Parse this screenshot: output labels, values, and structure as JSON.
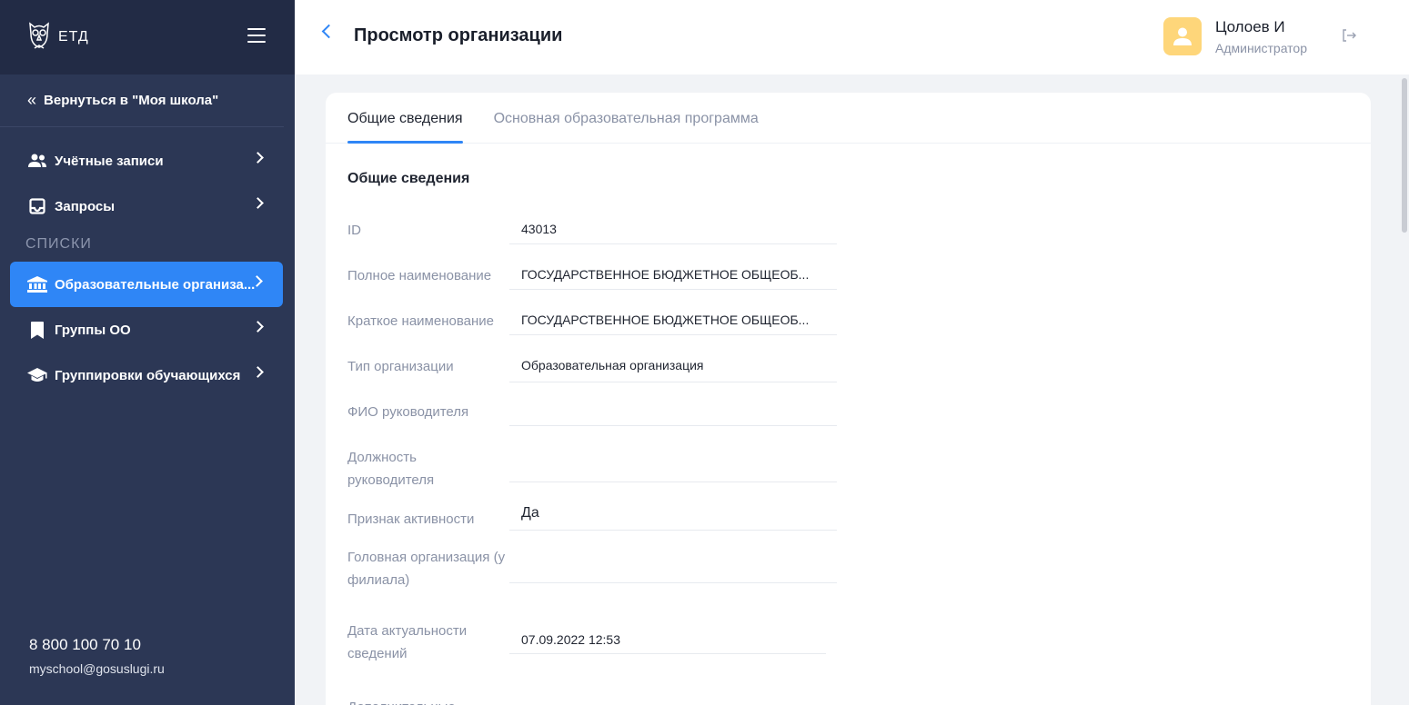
{
  "sidebar": {
    "logo_text": "ЕТД",
    "back_link": "Вернуться в \"Моя школа\"",
    "items": [
      {
        "label": "Учётные записи"
      },
      {
        "label": "Запросы"
      }
    ],
    "section_label": "СПИСКИ",
    "list_items": [
      {
        "label": "Образовательные организа..."
      },
      {
        "label": "Группы ОО"
      },
      {
        "label": "Группировки обучающихся"
      }
    ],
    "phone": "8 800 100 70 10",
    "email": "myschool@gosuslugi.ru"
  },
  "header": {
    "title": "Просмотр организации",
    "user_name": "Цолоев И",
    "user_role": "Администратор"
  },
  "tabs": [
    {
      "label": "Общие сведения"
    },
    {
      "label": "Основная образовательная программа"
    }
  ],
  "section_title": "Общие сведения",
  "fields": [
    {
      "label": "ID",
      "value": "43013"
    },
    {
      "label": "Полное наименование",
      "value": "ГОСУДАРСТВЕННОЕ БЮДЖЕТНОЕ ОБЩЕОБ..."
    },
    {
      "label": "Краткое наименование",
      "value": "ГОСУДАРСТВЕННОЕ БЮДЖЕТНОЕ ОБЩЕОБ..."
    },
    {
      "label": "Тип организации",
      "value": "Образовательная организация"
    },
    {
      "label": "ФИО руководителя",
      "value": ""
    },
    {
      "label": "Должность руководителя",
      "value": ""
    },
    {
      "label": "Признак активности",
      "value": "Да"
    },
    {
      "label": "Головная организация (у филиала)",
      "value": ""
    },
    {
      "label": "Дата актуальности сведений",
      "value": "07.09.2022 12:53"
    },
    {
      "label": "Дополнительные",
      "value": ""
    }
  ],
  "colors": {
    "sidebar_bg": "#2c3755",
    "sidebar_top_bg": "#222b45",
    "accent": "#2f86f6",
    "avatar_bg": "#fed67a"
  }
}
